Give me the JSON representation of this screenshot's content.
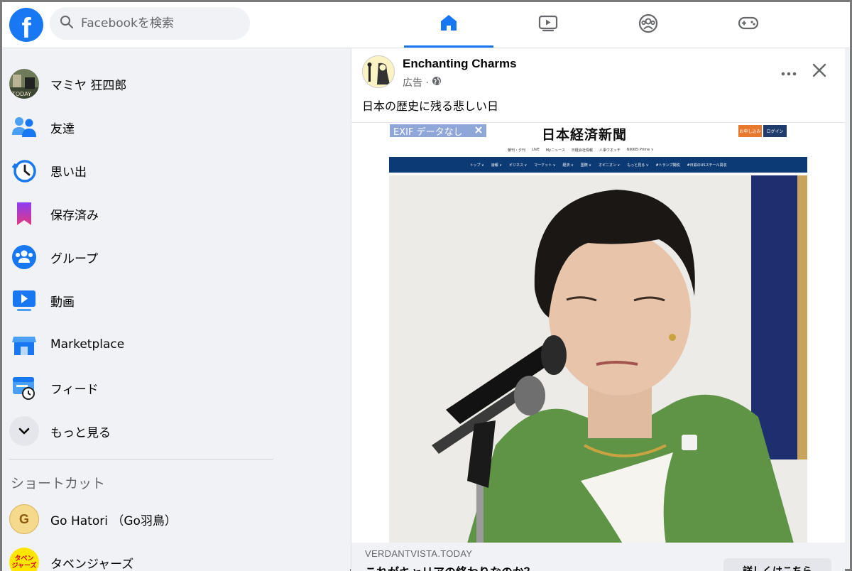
{
  "app": {
    "logo_letter": "f"
  },
  "search": {
    "placeholder": "Facebookを検索"
  },
  "sidebar": {
    "items": [
      {
        "label": "マミヤ 狂四郎"
      },
      {
        "label": "友達"
      },
      {
        "label": "思い出"
      },
      {
        "label": "保存済み"
      },
      {
        "label": "グループ"
      },
      {
        "label": "動画"
      },
      {
        "label": "Marketplace"
      },
      {
        "label": "フィード"
      },
      {
        "label": "もっと見る"
      }
    ],
    "shortcuts_title": "ショートカット",
    "shortcuts": [
      {
        "label": "Go Hatori （Go羽鳥）",
        "avatar_letter": "G"
      },
      {
        "label": "タベンジャーズ",
        "avatar_text": "タベン ジャーズ"
      }
    ]
  },
  "post": {
    "page_name": "Enchanting Charms",
    "sponsored": "広告 ·",
    "text": "日本の歴史に残る悲しい日",
    "image": {
      "exif_label": "EXIF データなし",
      "masthead": "日本経済新聞",
      "btn_subscribe": "お申し込み",
      "btn_login": "ログイン",
      "subnav": [
        "朝刊・夕刊",
        "LIVE",
        "Myニュース",
        "日経会社情報",
        "人事ウオッチ",
        "NIKKEI Prime ∨"
      ],
      "nav": [
        "トップ ∨",
        "速報 ∨",
        "ビジネス ∨",
        "マーケット ∨",
        "経済 ∨",
        "国際 ∨",
        "オピニオン ∨",
        "もっと見る ∨",
        "#トランプ関税",
        "#日鉄のUSスチール買収"
      ]
    },
    "link": {
      "domain": "VERDANTVISTA.TODAY",
      "headline": "これがキャリアの終わりなのか？",
      "cta": "詳しくはこちら"
    }
  },
  "colors": {
    "brand": "#1877f2",
    "nikkei_navy": "#0c3a74",
    "nikkei_orange": "#e8782c",
    "jacket_green": "#5f9447"
  }
}
